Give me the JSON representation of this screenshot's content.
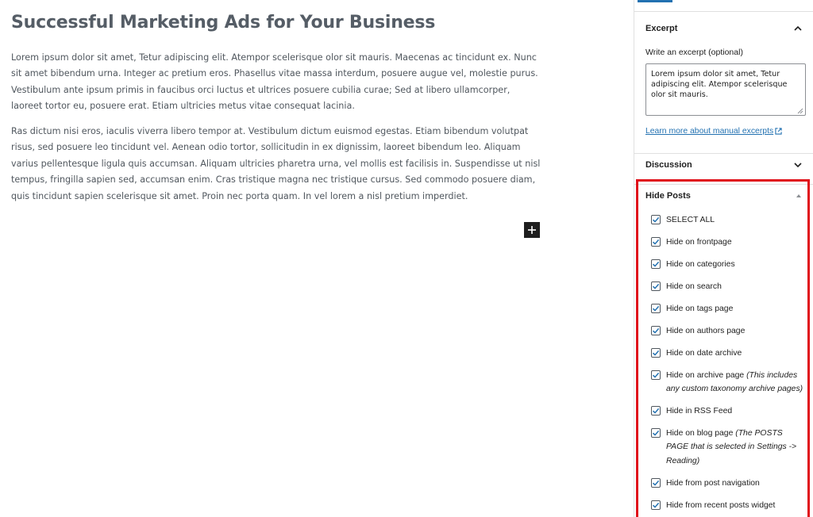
{
  "editor": {
    "title": "Successful Marketing Ads for Your Business",
    "paragraphs": [
      "Lorem ipsum dolor sit amet, Tetur adipiscing elit. Atempor scelerisque olor sit mauris. Maecenas ac tincidunt ex. Nunc sit amet bibendum urna. Integer ac pretium eros. Phasellus vitae massa interdum, posuere augue vel, molestie purus. Vestibulum ante ipsum primis in faucibus orci luctus et ultrices posuere cubilia curae; Sed at libero ullamcorper, laoreet tortor eu, posuere erat. Etiam ultricies metus vitae consequat lacinia.",
      "Ras dictum nisi eros, iaculis viverra libero tempor at. Vestibulum dictum euismod egestas. Etiam bibendum volutpat risus, sed posuere leo tincidunt vel. Aenean odio tortor, sollicitudin in ex dignissim, laoreet bibendum leo. Aliquam varius pellentesque ligula quis accumsan. Aliquam ultricies pharetra urna, vel mollis est facilisis in. Suspendisse ut nisl tempus, fringilla sapien sed, accumsan enim. Cras tristique magna nec tristique cursus. Sed commodo posuere diam, quis tincidunt sapien scelerisque sit amet. Proin nec porta quam. In vel lorem a nisl pretium imperdiet."
    ],
    "add_block_icon": "plus-icon"
  },
  "sidebar": {
    "excerpt": {
      "title": "Excerpt",
      "label": "Write an excerpt (optional)",
      "value": "Lorem ipsum dolor sit amet, Tetur adipiscing elit. Atempor scelerisque olor sit mauris.",
      "link": "Learn more about manual excerpts",
      "expanded": true
    },
    "discussion": {
      "title": "Discussion",
      "expanded": false
    },
    "hide_posts": {
      "title": "Hide Posts",
      "expanded": true,
      "options": [
        {
          "label": "SELECT ALL",
          "note": "",
          "checked": true
        },
        {
          "label": "Hide on frontpage",
          "note": "",
          "checked": true
        },
        {
          "label": "Hide on categories",
          "note": "",
          "checked": true
        },
        {
          "label": "Hide on search",
          "note": "",
          "checked": true
        },
        {
          "label": "Hide on tags page",
          "note": "",
          "checked": true
        },
        {
          "label": "Hide on authors page",
          "note": "",
          "checked": true
        },
        {
          "label": "Hide on date archive",
          "note": "",
          "checked": true
        },
        {
          "label": "Hide on archive page",
          "note": "(This includes any custom taxonomy archive pages)",
          "checked": true
        },
        {
          "label": "Hide in RSS Feed",
          "note": "",
          "checked": true
        },
        {
          "label": "Hide on blog page",
          "note": "(The POSTS PAGE that is selected in Settings -> Reading)",
          "checked": true
        },
        {
          "label": "Hide from post navigation",
          "note": "",
          "checked": true
        },
        {
          "label": "Hide from recent posts widget",
          "note": "",
          "checked": true
        }
      ]
    }
  },
  "colors": {
    "accent": "#2271b1",
    "highlight_border": "#e0101a",
    "checkbox_tick": "#2271b1"
  }
}
